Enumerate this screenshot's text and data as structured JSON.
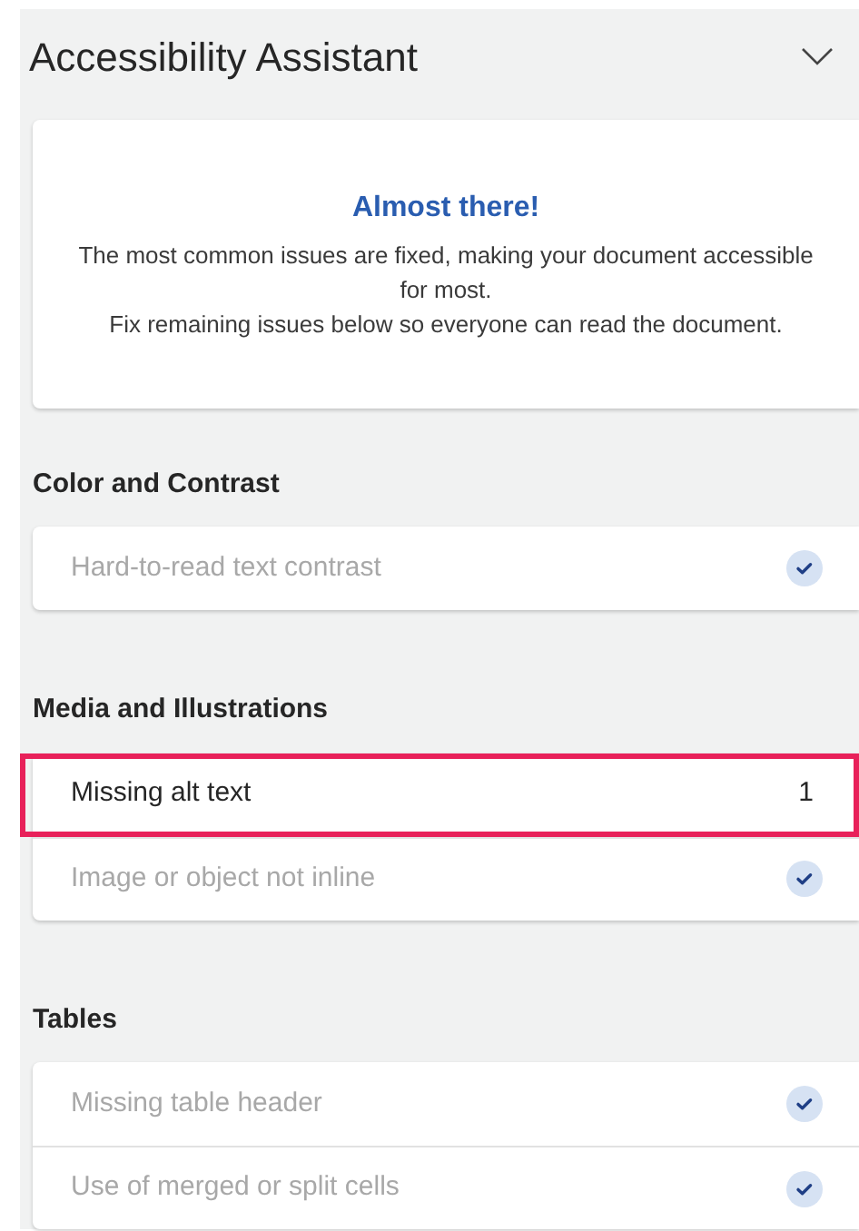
{
  "pane": {
    "title": "Accessibility Assistant"
  },
  "summary": {
    "heading": "Almost there!",
    "lines": [
      "The most common issues are fixed, making your document accessible for most.",
      "Fix remaining issues below so everyone can read the document."
    ]
  },
  "sections": [
    {
      "title": "Color and Contrast",
      "items": [
        {
          "label": "Hard-to-read text contrast",
          "fixed": true,
          "selected": false
        }
      ]
    },
    {
      "title": "Media and Illustrations",
      "items": [
        {
          "label": "Missing alt text",
          "fixed": false,
          "count": "1",
          "selected": true
        },
        {
          "label": "Image or object not inline",
          "fixed": true,
          "selected": false
        }
      ]
    },
    {
      "title": "Tables",
      "items": [
        {
          "label": "Missing table header",
          "fixed": true,
          "selected": false
        },
        {
          "label": "Use of merged or split cells",
          "fixed": true,
          "selected": false
        }
      ]
    }
  ]
}
